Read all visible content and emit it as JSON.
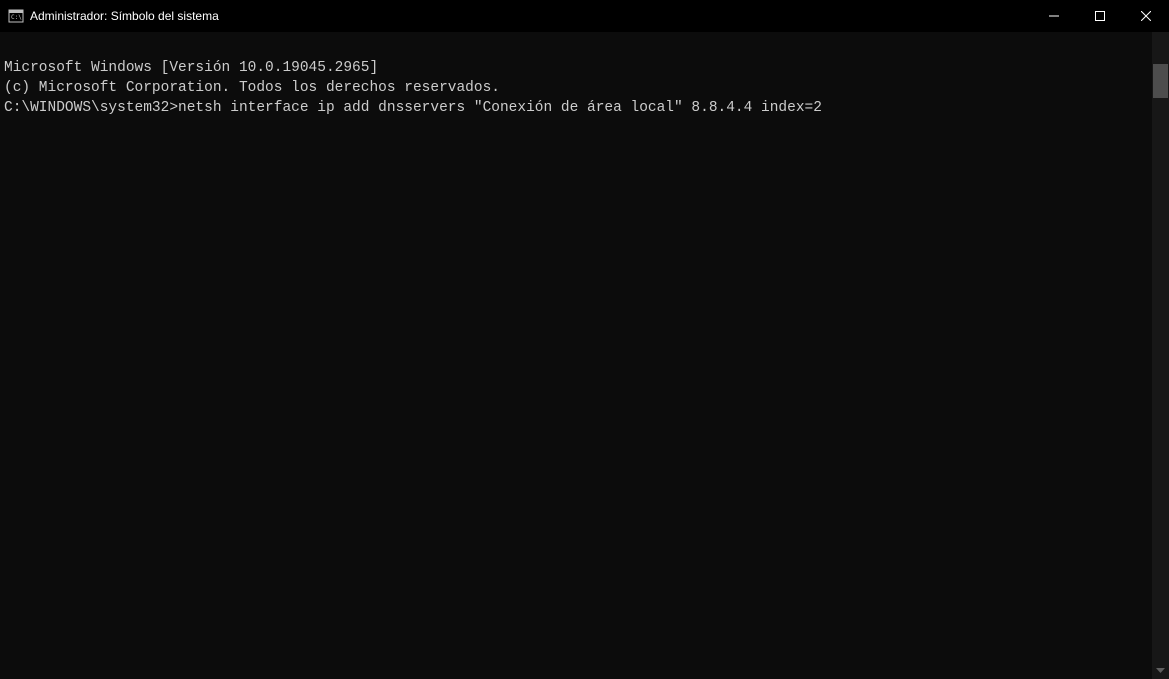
{
  "titlebar": {
    "title": "Administrador: Símbolo del sistema"
  },
  "terminal": {
    "line1": "Microsoft Windows [Versión 10.0.19045.2965]",
    "line2": "(c) Microsoft Corporation. Todos los derechos reservados.",
    "prompt": "C:\\WINDOWS\\system32>",
    "command": "netsh interface ip add dnsservers \"Conexión de área local\" 8.8.4.4 index=2"
  }
}
